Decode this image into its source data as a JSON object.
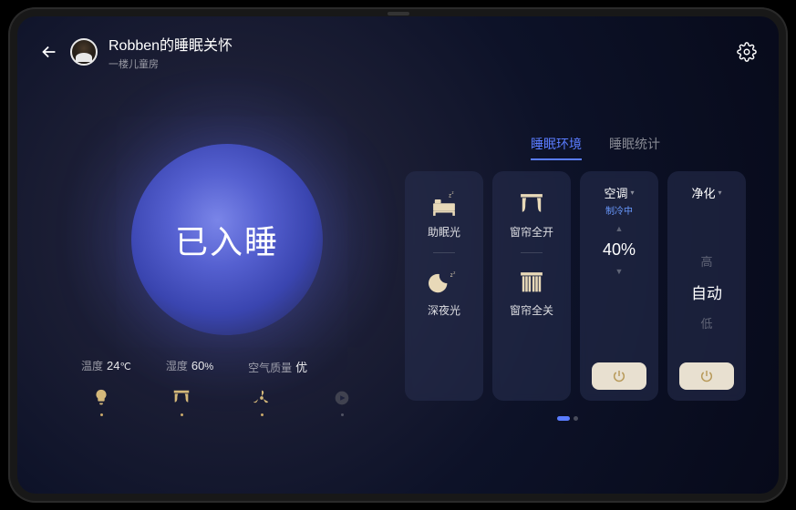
{
  "header": {
    "title": "Robben的睡眠关怀",
    "subtitle": "一楼儿童房"
  },
  "orb": {
    "status": "已入睡"
  },
  "stats": {
    "temp_label": "温度",
    "temp_value": "24",
    "temp_unit": "℃",
    "humidity_label": "湿度",
    "humidity_value": "60",
    "humidity_unit": "%",
    "air_label": "空气质量",
    "air_value": "优"
  },
  "tabs": {
    "env": "睡眠环境",
    "stats": "睡眠统计"
  },
  "cards": {
    "light": {
      "mode1": "助眠光",
      "mode2": "深夜光"
    },
    "curtain": {
      "open": "窗帘全开",
      "close": "窗帘全关"
    },
    "ac": {
      "title": "空调",
      "status": "制冷中",
      "value": "40%"
    },
    "purifier": {
      "title": "净化",
      "high": "高",
      "auto": "自动",
      "low": "低"
    }
  }
}
